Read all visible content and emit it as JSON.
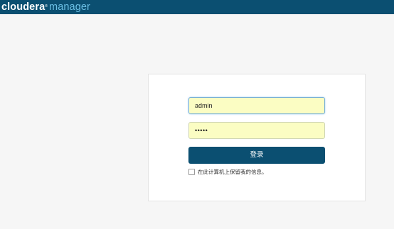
{
  "header": {
    "brand_text": "cloudera",
    "brand_mark": "®",
    "product_text": "manager",
    "bar_color": "#0b4f71",
    "product_color": "#6cc0e5"
  },
  "login": {
    "username_value": "admin",
    "password_value": "•••••",
    "submit_label": "登录",
    "remember_label": "在此计算机上保留我的信息。",
    "remember_checked": false,
    "field_color": "#fbfdc3",
    "button_color": "#0b4f71"
  }
}
